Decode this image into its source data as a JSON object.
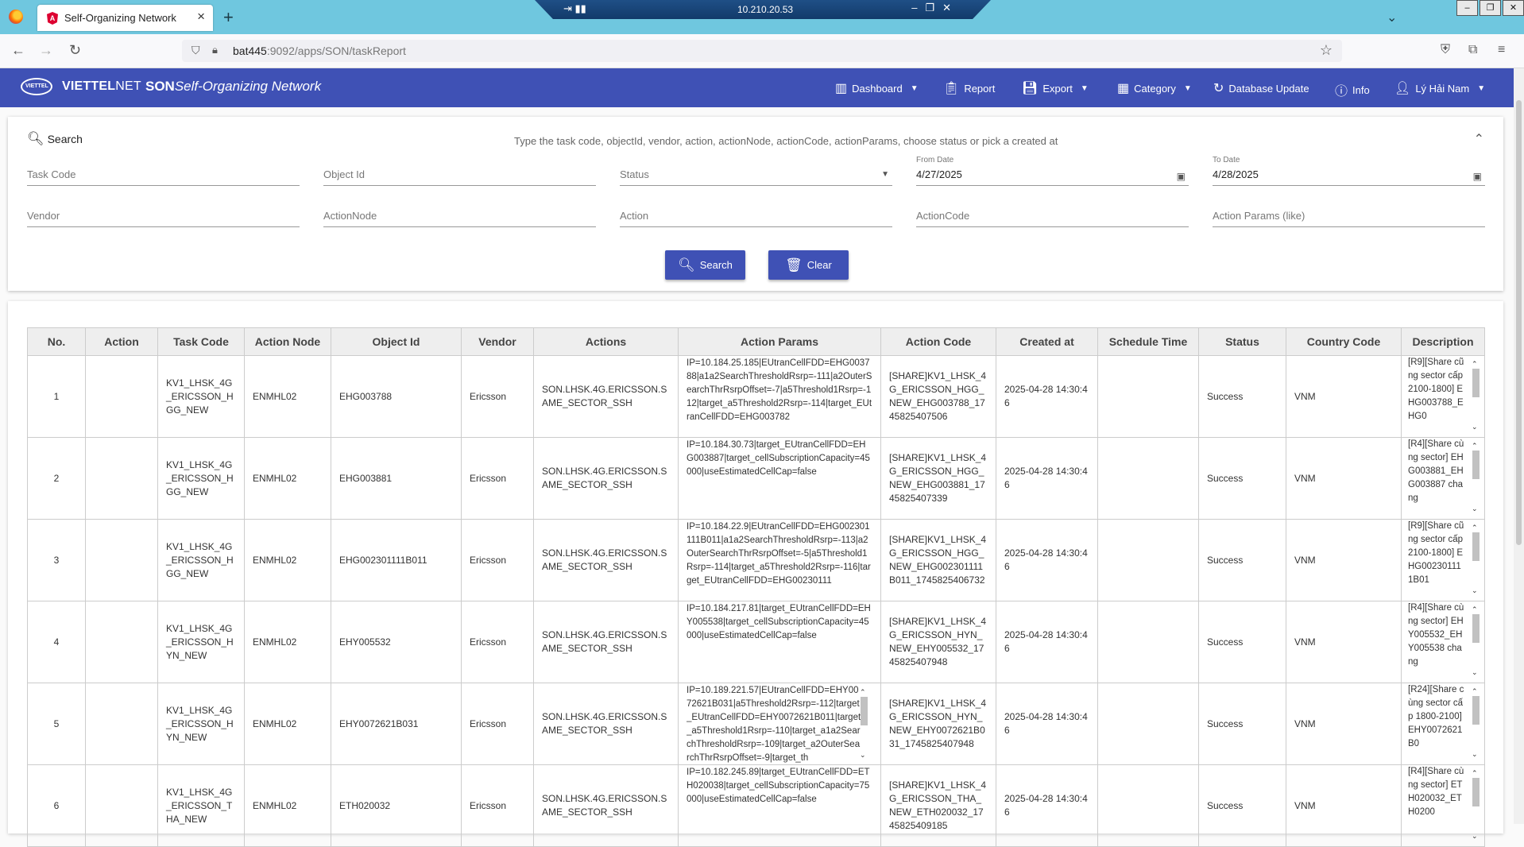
{
  "browser": {
    "tab_title": "Self-Organizing Network",
    "tab_favicon": "A",
    "remote_ip": "10.210.20.53",
    "url_host": "bat445",
    "url_rest": ":9092/apps/SON/taskReport"
  },
  "header": {
    "brand_bold": "VIETTEL",
    "brand_thin": "NET",
    "logo_text": "VIETTEL",
    "title_bold": "SON",
    "title_italic": "Self-Organizing Network",
    "menu": {
      "dashboard": "Dashboard",
      "report": "Report",
      "export": "Export",
      "category": "Category",
      "database_update": "Database Update",
      "info": "Info",
      "user": "Lý Hải Nam"
    }
  },
  "search": {
    "title": "Search",
    "hint": "Type the task code, objectId, vendor, action, actionNode, actionCode, actionParams, choose status or pick a created at",
    "task_code_ph": "Task Code",
    "object_id_ph": "Object Id",
    "status_ph": "Status",
    "from_label": "From Date",
    "from_value": "4/27/2025",
    "to_label": "To Date",
    "to_value": "4/28/2025",
    "vendor_ph": "Vendor",
    "action_node_ph": "ActionNode",
    "action_ph": "Action",
    "action_code_ph": "ActionCode",
    "action_params_ph": "Action Params (like)",
    "search_btn": "Search",
    "clear_btn": "Clear"
  },
  "table": {
    "headers": [
      "No.",
      "Action",
      "Task Code",
      "Action Node",
      "Object Id",
      "Vendor",
      "Actions",
      "Action Params",
      "Action Code",
      "Created at",
      "Schedule Time",
      "Status",
      "Country Code",
      "Description"
    ],
    "rows": [
      {
        "no": "1",
        "task_code": "KV1_LHSK_4G_ERICSSON_HGG_NEW",
        "node": "ENMHL02",
        "object_id": "EHG003788",
        "vendor": "Ericsson",
        "actions": "SON.LHSK.4G.ERICSSON.SAME_SECTOR_SSH",
        "params": "IP=10.184.25.185|EUtranCellFDD=EHG003788|a1a2SearchThresholdRsrp=-111|a2OuterSearchThrRsrpOffset=-7|a5Threshold1Rsrp=-112|target_a5Threshold2Rsrp=-114|target_EUtranCellFDD=EHG003782",
        "code": "[SHARE]KV1_LHSK_4G_ERICSSON_HGG_NEW_EHG003788_1745825407506",
        "created": "2025-04-28 14:30:46",
        "schedule": "",
        "status": "Success",
        "country": "VNM",
        "desc": "[R9][Share cũng sector cấp 2100-1800] EHG003788_EHG0"
      },
      {
        "no": "2",
        "task_code": "KV1_LHSK_4G_ERICSSON_HGG_NEW",
        "node": "ENMHL02",
        "object_id": "EHG003881",
        "vendor": "Ericsson",
        "actions": "SON.LHSK.4G.ERICSSON.SAME_SECTOR_SSH",
        "params": "IP=10.184.30.73|target_EUtranCellFDD=EHG003887|target_cellSubscriptionCapacity=45000|useEstimatedCellCap=false",
        "code": "[SHARE]KV1_LHSK_4G_ERICSSON_HGG_NEW_EHG003881_1745825407339",
        "created": "2025-04-28 14:30:46",
        "schedule": "",
        "status": "Success",
        "country": "VNM",
        "desc": "[R4][Share cùng sector] EHG003881_EHG003887 chang"
      },
      {
        "no": "3",
        "task_code": "KV1_LHSK_4G_ERICSSON_HGG_NEW",
        "node": "ENMHL02",
        "object_id": "EHG002301111B011",
        "vendor": "Ericsson",
        "actions": "SON.LHSK.4G.ERICSSON.SAME_SECTOR_SSH",
        "params": "IP=10.184.22.9|EUtranCellFDD=EHG002301111B011|a1a2SearchThresholdRsrp=-113|a2OuterSearchThrRsrpOffset=-5|a5Threshold1Rsrp=-114|target_a5Threshold2Rsrp=-116|target_EUtranCellFDD=EHG00230111",
        "code": "[SHARE]KV1_LHSK_4G_ERICSSON_HGG_NEW_EHG002301111B011_1745825406732",
        "created": "2025-04-28 14:30:46",
        "schedule": "",
        "status": "Success",
        "country": "VNM",
        "desc": "[R9][Share cũng sector cấp 2100-1800] EHG002301111B01"
      },
      {
        "no": "4",
        "task_code": "KV1_LHSK_4G_ERICSSON_HYN_NEW",
        "node": "ENMHL02",
        "object_id": "EHY005532",
        "vendor": "Ericsson",
        "actions": "SON.LHSK.4G.ERICSSON.SAME_SECTOR_SSH",
        "params": "IP=10.184.217.81|target_EUtranCellFDD=EHY005538|target_cellSubscriptionCapacity=45000|useEstimatedCellCap=false",
        "code": "[SHARE]KV1_LHSK_4G_ERICSSON_HYN_NEW_EHY005532_1745825407948",
        "created": "2025-04-28 14:30:46",
        "schedule": "",
        "status": "Success",
        "country": "VNM",
        "desc": "[R4][Share cùng sector] EHY005532_EHY005538 chang"
      },
      {
        "no": "5",
        "task_code": "KV1_LHSK_4G_ERICSSON_HYN_NEW",
        "node": "ENMHL02",
        "object_id": "EHY0072621B031",
        "vendor": "Ericsson",
        "actions": "SON.LHSK.4G.ERICSSON.SAME_SECTOR_SSH",
        "params": "IP=10.189.221.57|EUtranCellFDD=EHY0072621B031|a5Threshold2Rsrp=-112|target_EUtranCellFDD=EHY0072621B011|target_a5Threshold1Rsrp=-110|target_a1a2SearchThresholdRsrp=-109|target_a2OuterSearchThrRsrpOffset=-9|target_th",
        "code": "[SHARE]KV1_LHSK_4G_ERICSSON_HYN_NEW_EHY0072621B031_1745825407948",
        "created": "2025-04-28 14:30:46",
        "schedule": "",
        "status": "Success",
        "country": "VNM",
        "desc": "[R24][Share cùng sector cấp 1800-2100] EHY0072621B0"
      },
      {
        "no": "6",
        "task_code": "KV1_LHSK_4G_ERICSSON_THA_NEW",
        "node": "ENMHL02",
        "object_id": "ETH020032",
        "vendor": "Ericsson",
        "actions": "SON.LHSK.4G.ERICSSON.SAME_SECTOR_SSH",
        "params": "IP=10.182.245.89|target_EUtranCellFDD=ETH020038|target_cellSubscriptionCapacity=75000|useEstimatedCellCap=false",
        "code": "[SHARE]KV1_LHSK_4G_ERICSSON_THA_NEW_ETH020032_1745825409185",
        "created": "2025-04-28 14:30:46",
        "schedule": "",
        "status": "Success",
        "country": "VNM",
        "desc": "[R4][Share cùng sector] ETH020032_ETH0200"
      }
    ]
  }
}
